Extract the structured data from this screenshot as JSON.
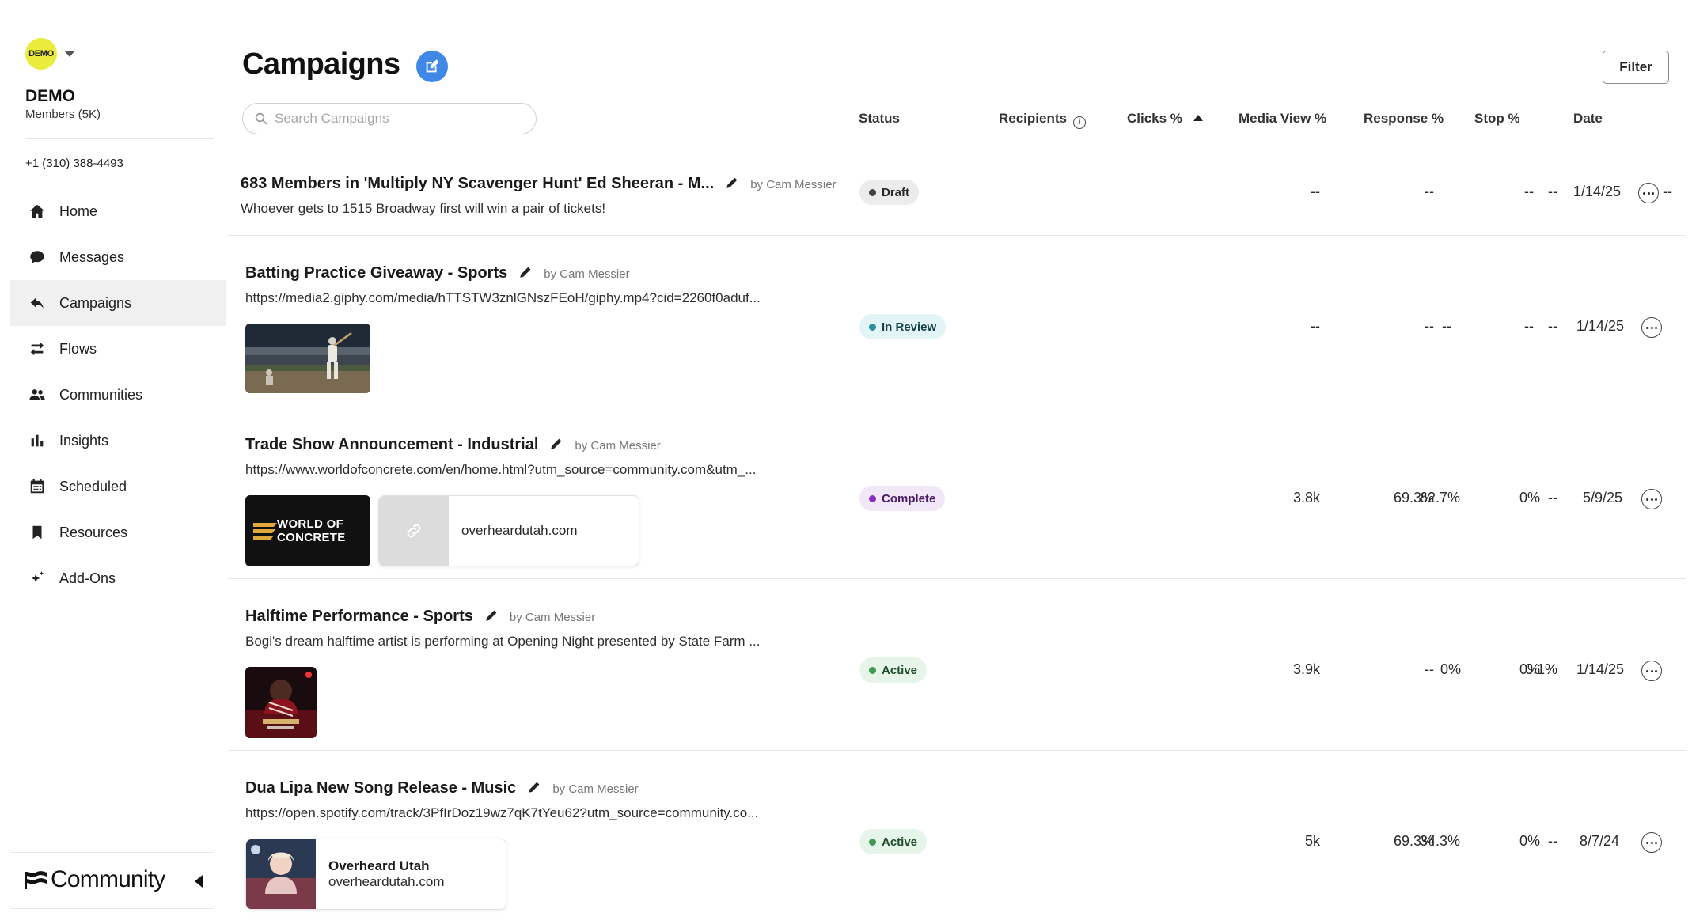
{
  "account": {
    "avatar_text": "DEMO",
    "name": "DEMO",
    "members": "Members (5K)",
    "phone": "+1 (310) 388-4493"
  },
  "nav": [
    {
      "label": "Home",
      "icon": "home-icon"
    },
    {
      "label": "Messages",
      "icon": "chat-bubble-icon"
    },
    {
      "label": "Campaigns",
      "icon": "reply-arrow-icon",
      "active": true
    },
    {
      "label": "Flows",
      "icon": "swap-arrows-icon"
    },
    {
      "label": "Communities",
      "icon": "people-icon"
    },
    {
      "label": "Insights",
      "icon": "bar-chart-icon"
    },
    {
      "label": "Scheduled",
      "icon": "calendar-icon"
    },
    {
      "label": "Resources",
      "icon": "bookmark-icon"
    },
    {
      "label": "Add-Ons",
      "icon": "sparkle-icon"
    }
  ],
  "brand": "Community",
  "page": {
    "title": "Campaigns",
    "filter_label": "Filter",
    "search_placeholder": "Search Campaigns"
  },
  "columns": {
    "status": "Status",
    "recipients": "Recipients",
    "clicks": "Clicks %",
    "media_view": "Media View %",
    "response": "Response %",
    "stop": "Stop %",
    "date": "Date"
  },
  "colors": {
    "accent": "#3f88e8",
    "avatar": "#e9ec3c",
    "draft": "#444444",
    "in_review": "#2a8fa0",
    "complete": "#8b2cc2",
    "active": "#3e9c52"
  },
  "rows": [
    {
      "title": "683 Members in 'Multiply NY Scavenger Hunt' Ed Sheeran - M...",
      "by": "by Cam Messier",
      "subtitle": "Whoever gets to 1515 Broadway first will win a pair of tickets!",
      "status": "Draft",
      "recipients": "--",
      "clicks": "--",
      "media_view": "--",
      "response": "--",
      "stop": "--",
      "date": "1/14/25"
    },
    {
      "title": "Batting Practice Giveaway - Sports",
      "by": "by Cam Messier",
      "subtitle": "https://media2.giphy.com/media/hTTSTW3znlGNszFEoH/giphy.mp4?cid=2260f0aduf...",
      "status": "In Review",
      "recipients": "--",
      "clicks": "--",
      "media_view": "--",
      "response": "--",
      "stop": "--",
      "date": "1/14/25"
    },
    {
      "title": "Trade Show Announcement - Industrial",
      "by": "by Cam Messier",
      "subtitle": "https://www.worldofconcrete.com/en/home.html?utm_source=community.com&utm_...",
      "status": "Complete",
      "recipients": "3.8k",
      "clicks": "69.3%",
      "media_view": "--",
      "response": "62.7%",
      "stop": "0%",
      "date": "5/9/25",
      "logo_line1": "WORLD OF",
      "logo_line2": "CONCRETE",
      "link_domain": "overheardutah.com"
    },
    {
      "title": "Halftime Performance - Sports",
      "by": "by Cam Messier",
      "subtitle": "Bogi's dream halftime artist is performing at Opening Night presented by State Farm ...",
      "status": "Active",
      "recipients": "3.9k",
      "clicks": "--",
      "media_view": "0.1%",
      "response": "0%",
      "stop": "0%",
      "date": "1/14/25"
    },
    {
      "title": "Dua Lipa New Song Release - Music",
      "by": "by Cam Messier",
      "subtitle": "https://open.spotify.com/track/3PfIrDoz19wz7qK7tYeu62?utm_source=community.co...",
      "status": "Active",
      "recipients": "5k",
      "clicks": "69.3%",
      "media_view": "--",
      "response": "34.3%",
      "stop": "0%",
      "date": "8/7/24",
      "link_title": "Overheard Utah",
      "link_domain": "overheardutah.com"
    }
  ]
}
